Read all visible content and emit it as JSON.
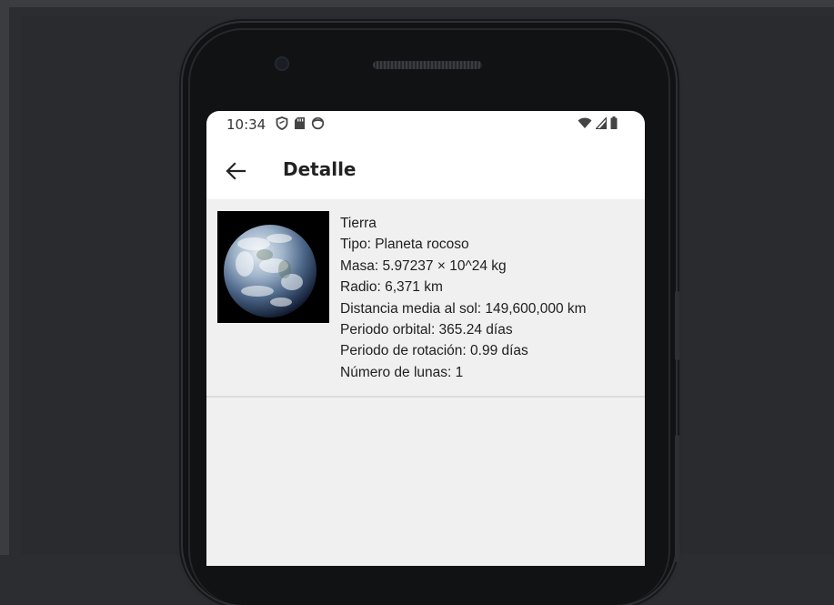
{
  "status_bar": {
    "time": "10:34"
  },
  "app_bar": {
    "title": "Detalle"
  },
  "planet": {
    "name": "Tierra",
    "type": "Tipo: Planeta rocoso",
    "mass": "Masa: 5.97237 × 10^24 kg",
    "radius": "Radio: 6,371 km",
    "distance": "Distancia media al sol: 149,600,000 km",
    "orbital_period": "Periodo orbital: 365.24 días",
    "rotation_period": "Periodo de rotación: 0.99 días",
    "moons": "Número de lunas: 1"
  },
  "colors": {
    "screen_bg": "#ffffff",
    "content_bg": "#f0f0f0",
    "text": "#1e1e1e"
  }
}
